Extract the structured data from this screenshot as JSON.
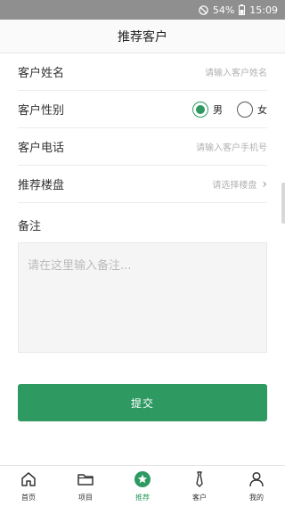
{
  "status_bar": {
    "battery": "54%",
    "time": "15:09"
  },
  "header": {
    "title": "推荐客户"
  },
  "form": {
    "name": {
      "label": "客户姓名",
      "placeholder": "请输入客户姓名"
    },
    "gender": {
      "label": "客户性别",
      "options": [
        "男",
        "女"
      ],
      "selected": "男"
    },
    "phone": {
      "label": "客户电话",
      "placeholder": "请输入客户手机号"
    },
    "project": {
      "label": "推荐楼盘",
      "placeholder": "请选择楼盘"
    },
    "remark": {
      "label": "备注",
      "placeholder": "请在这里输入备注..."
    }
  },
  "submit_label": "提交",
  "tabs": [
    {
      "label": "首页",
      "icon": "home-icon"
    },
    {
      "label": "项目",
      "icon": "folder-icon"
    },
    {
      "label": "推荐",
      "icon": "star-icon",
      "active": true
    },
    {
      "label": "客户",
      "icon": "tie-icon"
    },
    {
      "label": "我的",
      "icon": "person-icon"
    }
  ],
  "colors": {
    "accent": "#2e9a62",
    "status_bar": "#8f8f8f"
  }
}
